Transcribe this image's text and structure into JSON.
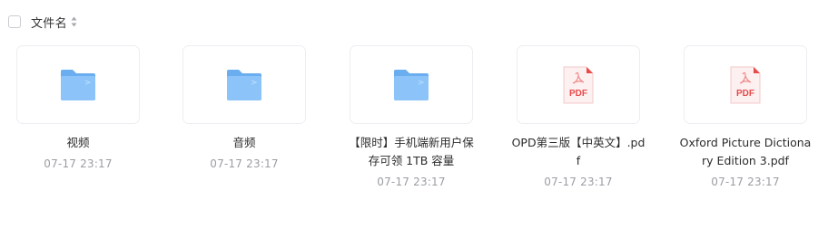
{
  "header": {
    "select_all_checked": false,
    "sort_label": "文件名",
    "sort_icon": "sort-updown-icon"
  },
  "items": [
    {
      "type": "folder",
      "icon": "folder-icon",
      "name": "视频",
      "time": "07-17 23:17"
    },
    {
      "type": "folder",
      "icon": "folder-icon",
      "name": "音频",
      "time": "07-17 23:17"
    },
    {
      "type": "folder",
      "icon": "folder-icon",
      "name": "【限时】手机端新用户保存可领 1TB 容量",
      "time": "07-17 23:17"
    },
    {
      "type": "pdf",
      "icon": "pdf-file-icon",
      "icon_label": "PDF",
      "name": "OPD第三版【中英文】.pdf",
      "time": "07-17 23:17"
    },
    {
      "type": "pdf",
      "icon": "pdf-file-icon",
      "icon_label": "PDF",
      "name": "Oxford Picture Dictionary Edition 3.pdf",
      "time": "07-17 23:17"
    }
  ],
  "colors": {
    "folder_back": "#6aaef0",
    "folder_front": "#8cc4fa",
    "pdf_red": "#e84a4a",
    "pdf_paper": "#fdf0f0"
  }
}
